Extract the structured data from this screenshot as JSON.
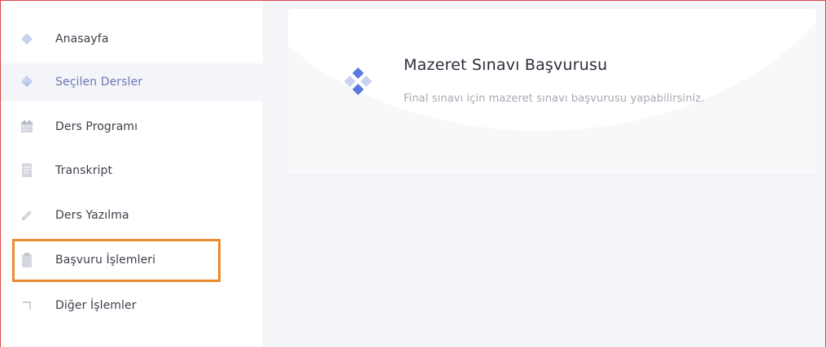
{
  "sidebar": {
    "items": [
      {
        "label": "Anasayfa",
        "icon": "diamond-icon"
      },
      {
        "label": "Seçilen Dersler",
        "icon": "drop-icon"
      },
      {
        "label": "Ders Programı",
        "icon": "calendar-icon"
      },
      {
        "label": "Transkript",
        "icon": "document-icon"
      },
      {
        "label": "Ders Yazılma",
        "icon": "pencil-icon"
      },
      {
        "label": "Başvuru İşlemleri",
        "icon": "clipboard-icon"
      },
      {
        "label": "Diğer İşlemler",
        "icon": "corner-arrow-icon"
      }
    ],
    "active_index": 1,
    "highlighted_index": 5
  },
  "card": {
    "title": "Mazeret Sınavı Başvurusu",
    "description": "Final sınavı için mazeret sınavı başvurusu yapabilirsiniz.",
    "icon": "diamond-cluster-icon"
  },
  "colors": {
    "accent": "#5b77e0",
    "highlight_border": "#ec8a2f",
    "window_border": "#d84848",
    "icon_light": "#c8d1ef"
  }
}
